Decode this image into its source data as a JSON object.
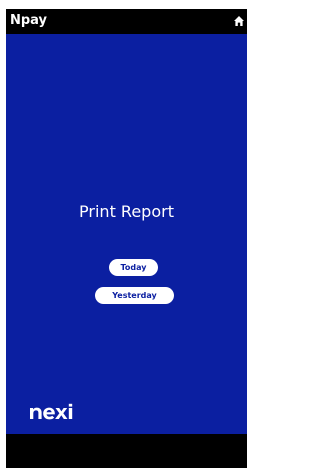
{
  "app": {
    "title": "Npay"
  },
  "header": {
    "home_icon": "home-icon"
  },
  "main": {
    "title": "Print Report",
    "buttons": [
      {
        "label": "Today"
      },
      {
        "label": "Yesterday"
      }
    ]
  },
  "brand": {
    "logo_text": "nexi",
    "logo_icon": "nexi-logo"
  },
  "colors": {
    "background": "#0b1fa1",
    "bar": "#000000",
    "text": "#ffffff",
    "button_text": "#0b1fa1"
  }
}
